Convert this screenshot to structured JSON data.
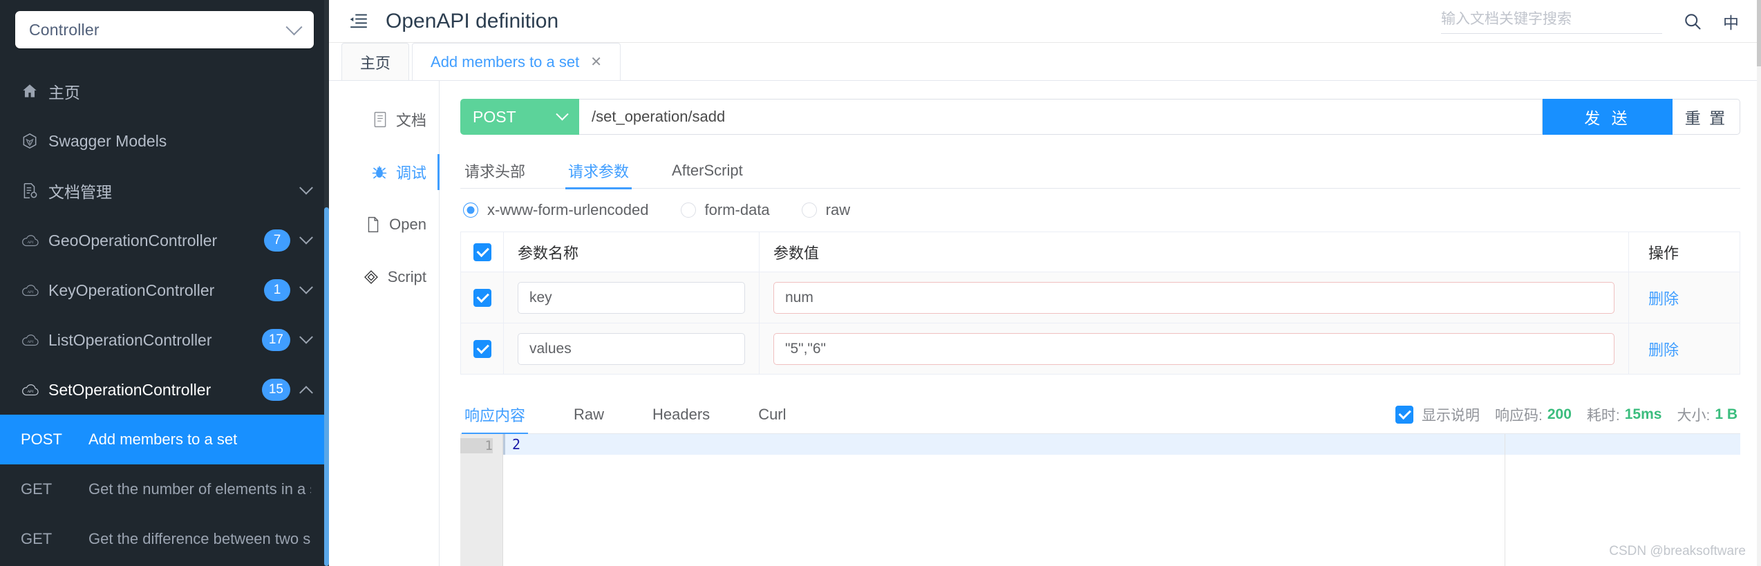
{
  "sidebar": {
    "selector": {
      "value": "Controller",
      "icon": "chevron-down-icon"
    },
    "nav": [
      {
        "label": "主页",
        "icon": "home-icon",
        "badge": null,
        "caret": null
      },
      {
        "label": "Swagger Models",
        "icon": "cube-icon",
        "badge": null,
        "caret": null
      },
      {
        "label": "文档管理",
        "icon": "document-settings-icon",
        "badge": null,
        "caret": "down"
      },
      {
        "label": "GeoOperationController",
        "icon": "api-cloud-icon",
        "badge": "7",
        "caret": "down"
      },
      {
        "label": "KeyOperationController",
        "icon": "api-cloud-icon",
        "badge": "1",
        "caret": "down"
      },
      {
        "label": "ListOperationController",
        "icon": "api-cloud-icon",
        "badge": "17",
        "caret": "down"
      },
      {
        "label": "SetOperationController",
        "icon": "api-cloud-icon",
        "badge": "15",
        "caret": "up"
      }
    ],
    "operations": [
      {
        "method": "POST",
        "summary": "Add members to a set",
        "selected": true
      },
      {
        "method": "GET",
        "summary": "Get the number of elements in a se",
        "selected": false
      },
      {
        "method": "GET",
        "summary": "Get the difference between two se",
        "selected": false
      }
    ]
  },
  "topbar": {
    "menu_icon": "menu-fold-icon",
    "title": "OpenAPI definition",
    "search": {
      "placeholder": "输入文档关键字搜索",
      "value": ""
    },
    "search_icon": "search-icon",
    "lang_button": "中"
  },
  "tabs": [
    {
      "label": "主页",
      "active": false,
      "closable": false
    },
    {
      "label": "Add members to a set",
      "active": true,
      "closable": true,
      "close_icon": "close-icon"
    }
  ],
  "innernav": [
    {
      "label": "文档",
      "icon": "document-icon",
      "active": false
    },
    {
      "label": "调试",
      "icon": "bug-icon",
      "active": true
    },
    {
      "label": "Open",
      "icon": "file-icon",
      "active": false
    },
    {
      "label": "Script",
      "icon": "script-icon",
      "active": false
    }
  ],
  "request": {
    "method": "POST",
    "method_caret": "chevron-down-icon",
    "url": "/set_operation/sadd",
    "send_label": "发 送",
    "reset_label": "重 置",
    "subtabs": [
      {
        "label": "请求头部",
        "active": false
      },
      {
        "label": "请求参数",
        "active": true
      },
      {
        "label": "AfterScript",
        "active": false
      }
    ],
    "body_types": [
      {
        "label": "x-www-form-urlencoded",
        "checked": true
      },
      {
        "label": "form-data",
        "checked": false
      },
      {
        "label": "raw",
        "checked": false
      }
    ],
    "params_table": {
      "headers": {
        "name": "参数名称",
        "value": "参数值",
        "action": "操作"
      },
      "header_checked": true,
      "rows": [
        {
          "checked": true,
          "name": "key",
          "value": "num",
          "action": "删除",
          "value_warn": true
        },
        {
          "checked": true,
          "name": "values",
          "value": "\"5\",\"6\"",
          "action": "删除",
          "value_warn": true
        }
      ]
    }
  },
  "response": {
    "tabs": [
      {
        "label": "响应内容",
        "active": true
      },
      {
        "label": "Raw",
        "active": false
      },
      {
        "label": "Headers",
        "active": false
      },
      {
        "label": "Curl",
        "active": false
      }
    ],
    "show_desc": {
      "label": "显示说明",
      "checked": true
    },
    "status_code_key": "响应码:",
    "status_code_value": "200",
    "time_key": "耗时:",
    "time_value": "15ms",
    "size_key": "大小:",
    "size_value": "1 B",
    "body_lines": [
      {
        "no": "1",
        "text": "2"
      }
    ]
  },
  "watermark": "CSDN @breaksoftware",
  "colors": {
    "sidebar_bg": "#1f272e",
    "accent": "#409eff",
    "selected": "#1890ff",
    "post_green": "#5cd39a",
    "status_green": "#3bbd7e",
    "badge": "#409eff"
  }
}
